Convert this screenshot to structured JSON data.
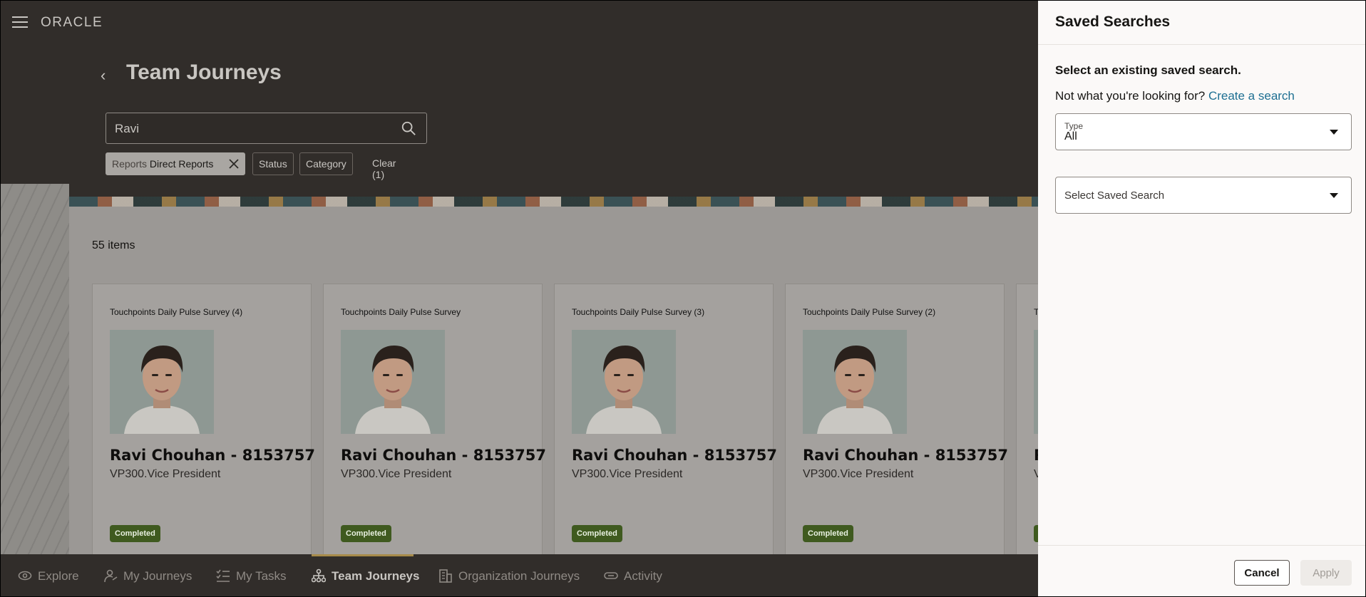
{
  "app": {
    "logo": "ORACLE"
  },
  "header": {
    "title": "Team Journeys",
    "search": {
      "value": "Ravi",
      "placeholder": ""
    },
    "filters": {
      "reports_key": "Reports",
      "reports_value": "Direct Reports",
      "status": "Status",
      "category": "Category",
      "clear": "Clear (1)"
    }
  },
  "content": {
    "items_count": "55 items",
    "cards": [
      {
        "title": "Touchpoints Daily Pulse Survey (4)",
        "name": "Ravi Chouhan - 8153757",
        "role": "VP300.Vice President",
        "status": "Completed"
      },
      {
        "title": "Touchpoints Daily Pulse Survey",
        "name": "Ravi Chouhan - 8153757",
        "role": "VP300.Vice President",
        "status": "Completed"
      },
      {
        "title": "Touchpoints Daily Pulse Survey (3)",
        "name": "Ravi Chouhan - 8153757",
        "role": "VP300.Vice President",
        "status": "Completed"
      },
      {
        "title": "Touchpoints Daily Pulse Survey (2)",
        "name": "Ravi Chouhan - 8153757",
        "role": "VP300.Vice President",
        "status": "Completed"
      },
      {
        "title": "T",
        "name": "R",
        "role": "V",
        "status": ""
      }
    ]
  },
  "bottom_nav": [
    {
      "label": "Explore",
      "icon": "eye-icon"
    },
    {
      "label": "My Journeys",
      "icon": "person-path-icon"
    },
    {
      "label": "My Tasks",
      "icon": "checklist-icon"
    },
    {
      "label": "Team Journeys",
      "icon": "hierarchy-icon",
      "active": true
    },
    {
      "label": "Organization Journeys",
      "icon": "building-icon"
    },
    {
      "label": "Activity",
      "icon": "link-icon"
    }
  ],
  "panel": {
    "title": "Saved Searches",
    "instruction": "Select an existing saved search.",
    "not_what": "Not what you're looking for?",
    "create_link": "Create a search",
    "type_label": "Type",
    "type_value": "All",
    "saved_placeholder": "Select Saved Search",
    "cancel": "Cancel",
    "apply": "Apply"
  },
  "colors": {
    "link": "#1d6f92",
    "badge": "#3f5a1f",
    "nav_active_underline": "#a78b4a"
  }
}
